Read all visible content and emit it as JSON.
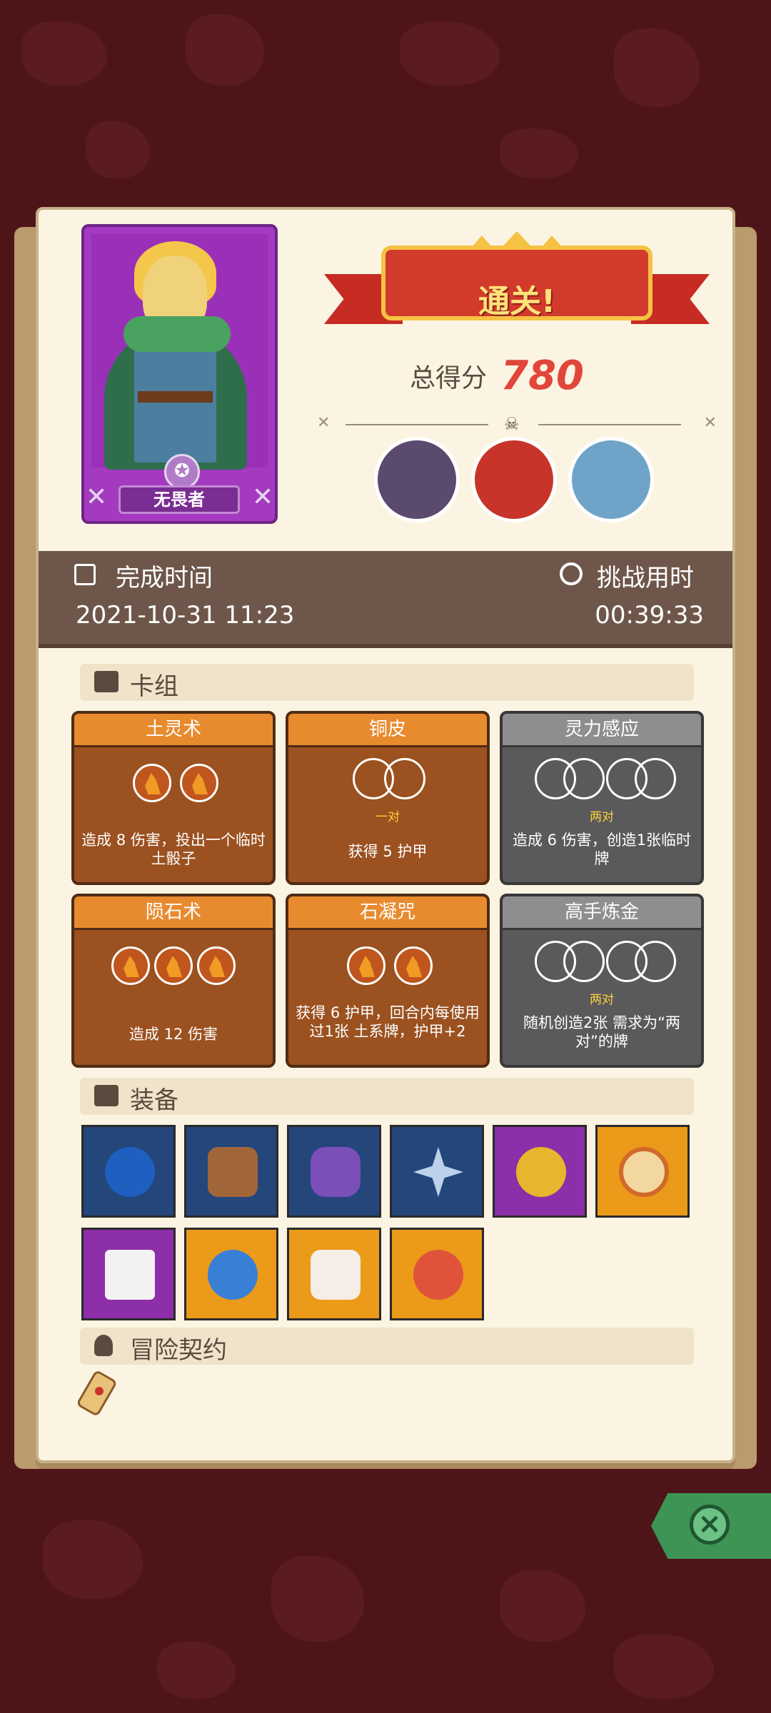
{
  "hero": {
    "name": "无畏者"
  },
  "result": {
    "banner": "通关!",
    "score_label": "总得分",
    "score_value": "780"
  },
  "bosses": [
    {
      "icon": "boss-stone-golem-icon",
      "color": "#5a4a6e"
    },
    {
      "icon": "boss-red-cage-icon",
      "color": "#c8342a"
    },
    {
      "icon": "boss-yeti-icon",
      "color": "#6fa4c8"
    }
  ],
  "time": {
    "complete_label": "完成时间",
    "complete_value": "2021-10-31 11:23",
    "challenge_label": "挑战用时",
    "challenge_value": "00:39:33"
  },
  "sections": {
    "deck": "卡组",
    "equipment": "装备",
    "contract": "冒险契约"
  },
  "cards": [
    {
      "title": "土灵术",
      "type": "earth",
      "pair": "",
      "desc": "造成 8 伤害，投出一个临时土骰子"
    },
    {
      "title": "铜皮",
      "type": "earth",
      "pair": "一对",
      "desc": "获得 5 护甲"
    },
    {
      "title": "灵力感应",
      "type": "gray",
      "pair": "两对",
      "desc": "造成 6 伤害，创造1张临时牌"
    },
    {
      "title": "陨石术",
      "type": "earth",
      "pair": "",
      "desc": "造成 12 伤害"
    },
    {
      "title": "石凝咒",
      "type": "earth",
      "pair": "",
      "desc": "获得 6 护甲，回合内每使用过1张 土系牌，护甲+2"
    },
    {
      "title": "高手炼金",
      "type": "gray",
      "pair": "两对",
      "desc": "随机创造2张 需求为“两对”的牌"
    }
  ],
  "equipment": [
    {
      "icon": "squid-icon",
      "bg": "blue"
    },
    {
      "icon": "horn-icon",
      "bg": "blue"
    },
    {
      "icon": "claw-icon",
      "bg": "blue"
    },
    {
      "icon": "snowflake-medal-icon",
      "bg": "blue"
    },
    {
      "icon": "gem-ring-icon",
      "bg": "purple"
    },
    {
      "icon": "gold-coin-icon",
      "bg": "orange"
    },
    {
      "icon": "broken-die-icon",
      "bg": "purple"
    },
    {
      "icon": "blue-mushroom-icon",
      "bg": "orange"
    },
    {
      "icon": "crystal-jar-icon",
      "bg": "orange"
    },
    {
      "icon": "meat-icon",
      "bg": "orange"
    }
  ],
  "contract_icon": "scroll-icon",
  "colors": {
    "accent_red": "#e1463a",
    "panel": "#fcf4e2",
    "close_green": "#3d9455"
  }
}
